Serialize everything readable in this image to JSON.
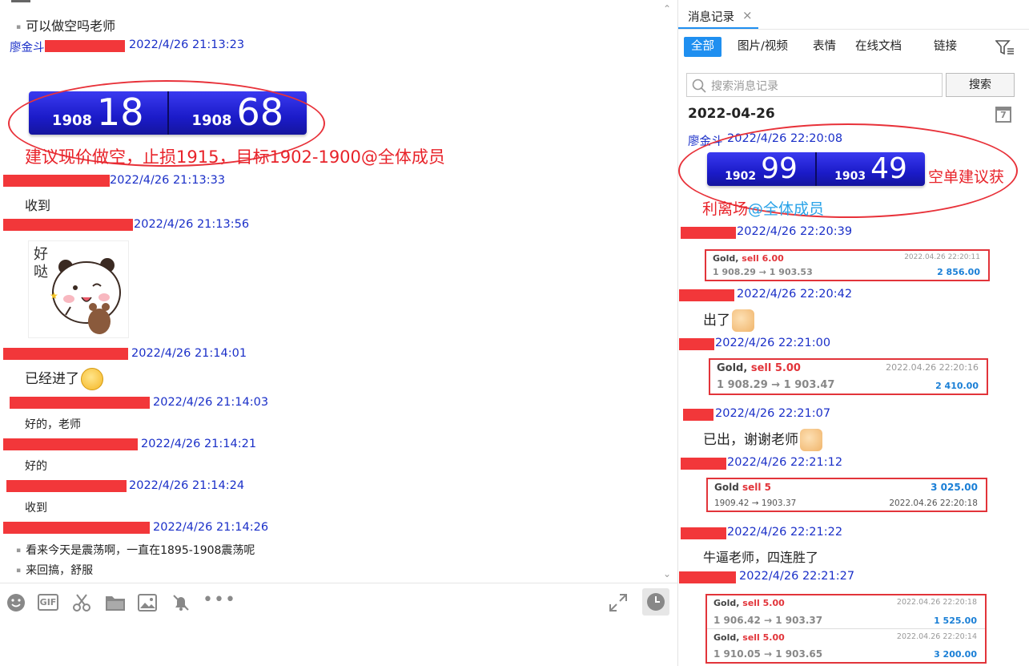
{
  "left_chat": {
    "messages": [
      {
        "text": "可以做空吗老师"
      },
      {
        "sender": "廖金斗",
        "time": "2022/4/26 21:13:23"
      },
      {
        "quote": {
          "left_small": "1908",
          "left_big": "18",
          "right_small": "1908",
          "right_big": "68"
        }
      },
      {
        "annotation": "建议现价做空，止损1915，目标1902-1900@全体成员"
      },
      {
        "time": "2022/4/26 21:13:33",
        "text": "收到"
      },
      {
        "time": "2022/4/26 21:13:56",
        "sticker": "好哒"
      },
      {
        "time": "2022/4/26 21:14:01",
        "text": "已经进了"
      },
      {
        "time": "2022/4/26 21:14:03",
        "text": "好的，老师"
      },
      {
        "time": "2022/4/26 21:14:21",
        "text": "好的"
      },
      {
        "time": "2022/4/26 21:14:24",
        "text": "收到"
      },
      {
        "time": "2022/4/26 21:14:26",
        "lines": [
          "看来今天是震荡啊，一直在1895-1908震荡呢",
          "来回搞，舒服"
        ]
      }
    ],
    "toolbar": [
      "smile-icon",
      "gif-icon",
      "scissors-icon",
      "folder-icon",
      "image-icon",
      "bell-off-icon",
      "more-icon",
      "expand-icon",
      "history-icon"
    ],
    "toolbar_gif_label": "GIF"
  },
  "right_panel": {
    "tab_title": "消息记录",
    "close_glyph": "×",
    "filters": [
      "全部",
      "图片/视频",
      "表情",
      "在线文档",
      "链接"
    ],
    "search_placeholder": "搜索消息记录",
    "search_button": "搜索",
    "date": "2022-04-26",
    "calendar_day": "7",
    "sender": "廖金斗",
    "first_time": "2022/4/26 22:20:08",
    "quote": {
      "left_small": "1902",
      "left_big": "99",
      "right_small": "1903",
      "right_big": "49"
    },
    "annotation_line1": "空单建议获",
    "annotation_line2": "利离场",
    "mention": "@全体成员",
    "entries": [
      {
        "time": "2022/4/26 22:20:39"
      },
      {
        "time": "2022/4/26 22:20:42",
        "text": "出了"
      },
      {
        "time": "2022/4/26 22:21:00"
      },
      {
        "time": "2022/4/26 22:21:07",
        "text": "已出，谢谢老师"
      },
      {
        "time": "2022/4/26 22:21:12"
      },
      {
        "time": "2022/4/26 22:21:22",
        "text": "牛逼老师，四连胜了"
      },
      {
        "time": "2022/4/26 22:21:27"
      }
    ],
    "trades": [
      {
        "symbol": "Gold,",
        "side": "sell 6.00",
        "prices": "1 908.29 → 1 903.53",
        "date": "2022.04.26 22:20:11",
        "profit": "2 856.00"
      },
      {
        "symbol": "Gold,",
        "side": "sell 5.00",
        "prices": "1 908.29 → 1 903.47",
        "date": "2022.04.26 22:20:16",
        "profit": "2 410.00"
      },
      {
        "symbol": "Gold",
        "side": "sell 5",
        "prices": "1909.42 → 1903.37",
        "date": "2022.04.26 22:20:18",
        "profit": "3 025.00"
      },
      {
        "symbol": "Gold,",
        "side": "sell 5.00",
        "prices": "1 906.42 → 1 903.37",
        "date": "2022.04.26 22:20:18",
        "profit": "1 525.00"
      },
      {
        "symbol": "Gold,",
        "side": "sell 5.00",
        "prices": "1 910.05 → 1 903.65",
        "date": "2022.04.26 22:20:14",
        "profit": "3 200.00"
      }
    ]
  },
  "colors": {
    "timestamp": "#1a2fc8",
    "redaction": "#f2373a",
    "annotation": "#e8232a",
    "accent": "#1f8ff0",
    "profit": "#1a7fd6"
  }
}
